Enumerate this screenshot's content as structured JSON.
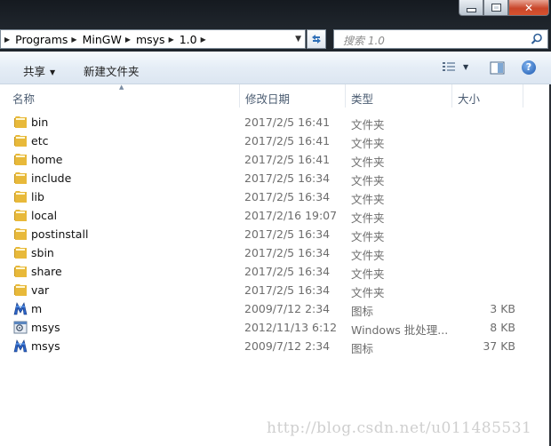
{
  "window": {
    "controls": {
      "minimize": "minimize",
      "maximize": "maximize",
      "close": "✕"
    }
  },
  "address": {
    "breadcrumb": [
      "Programs",
      "MinGW",
      "msys",
      "1.0"
    ]
  },
  "search": {
    "placeholder": "搜索 1.0"
  },
  "toolbar": {
    "share": "共享",
    "new_folder": "新建文件夹"
  },
  "columns": {
    "name": "名称",
    "date": "修改日期",
    "type": "类型",
    "size": "大小"
  },
  "files": [
    {
      "name": "bin",
      "date": "2017/2/5 16:41",
      "type": "文件夹",
      "size": "",
      "icon": "folder-icon"
    },
    {
      "name": "etc",
      "date": "2017/2/5 16:41",
      "type": "文件夹",
      "size": "",
      "icon": "folder-icon"
    },
    {
      "name": "home",
      "date": "2017/2/5 16:41",
      "type": "文件夹",
      "size": "",
      "icon": "folder-icon"
    },
    {
      "name": "include",
      "date": "2017/2/5 16:34",
      "type": "文件夹",
      "size": "",
      "icon": "folder-icon"
    },
    {
      "name": "lib",
      "date": "2017/2/5 16:34",
      "type": "文件夹",
      "size": "",
      "icon": "folder-icon"
    },
    {
      "name": "local",
      "date": "2017/2/16 19:07",
      "type": "文件夹",
      "size": "",
      "icon": "folder-icon"
    },
    {
      "name": "postinstall",
      "date": "2017/2/5 16:34",
      "type": "文件夹",
      "size": "",
      "icon": "folder-icon"
    },
    {
      "name": "sbin",
      "date": "2017/2/5 16:34",
      "type": "文件夹",
      "size": "",
      "icon": "folder-icon"
    },
    {
      "name": "share",
      "date": "2017/2/5 16:34",
      "type": "文件夹",
      "size": "",
      "icon": "folder-icon"
    },
    {
      "name": "var",
      "date": "2017/2/5 16:34",
      "type": "文件夹",
      "size": "",
      "icon": "folder-icon"
    },
    {
      "name": "m",
      "date": "2009/7/12 2:34",
      "type": "图标",
      "size": "3 KB",
      "icon": "msys-logo-icon"
    },
    {
      "name": "msys",
      "date": "2012/11/13 6:12",
      "type": "Windows 批处理...",
      "size": "8 KB",
      "icon": "batch-file-icon"
    },
    {
      "name": "msys",
      "date": "2009/7/12 2:34",
      "type": "图标",
      "size": "37 KB",
      "icon": "msys-logo-icon"
    }
  ],
  "watermark": "http://blog.csdn.net/u011485531",
  "colors": {
    "folder": "#e8b93a",
    "accent": "#2f6fb7",
    "titlebar": "#1a1f25"
  }
}
